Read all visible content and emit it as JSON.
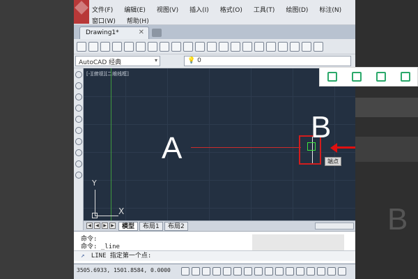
{
  "menu": {
    "row1": [
      "文件(F)",
      "编辑(E)",
      "视图(V)",
      "插入(I)",
      "格式(O)",
      "工具(T)",
      "绘图(D)",
      "标注(N)"
    ],
    "row2": [
      "窗口(W)",
      "帮助(H)"
    ]
  },
  "tabs": {
    "document": "Drawing1*",
    "close": "✕"
  },
  "workspace": {
    "value": "AutoCAD 经典",
    "arrow": "▾",
    "layer_value": "0"
  },
  "canvas": {
    "view_label": "[-][俯视][二维线框]",
    "point_a": "A",
    "point_b": "B",
    "snap_tooltip": "端点",
    "ucs_y": "Y",
    "ucs_x": "X"
  },
  "layout_tabs": [
    "模型",
    "布局1",
    "布局2"
  ],
  "command": {
    "line1": "命令:",
    "line2": "命令: _line",
    "prompt": "LINE 指定第一个点:"
  },
  "status": {
    "coordinates": "3505.6933, 1501.8584, 0.0000"
  },
  "side": {
    "big_letter": "B"
  },
  "colors": {
    "canvas_bg": "#233041",
    "accent_red": "#d21d1d",
    "snap_green": "#3ce63c",
    "share_green": "#2aa86a"
  },
  "icons": {
    "share_bar": [
      "phone-icon",
      "expand-icon",
      "save-icon",
      "share-icon"
    ]
  }
}
